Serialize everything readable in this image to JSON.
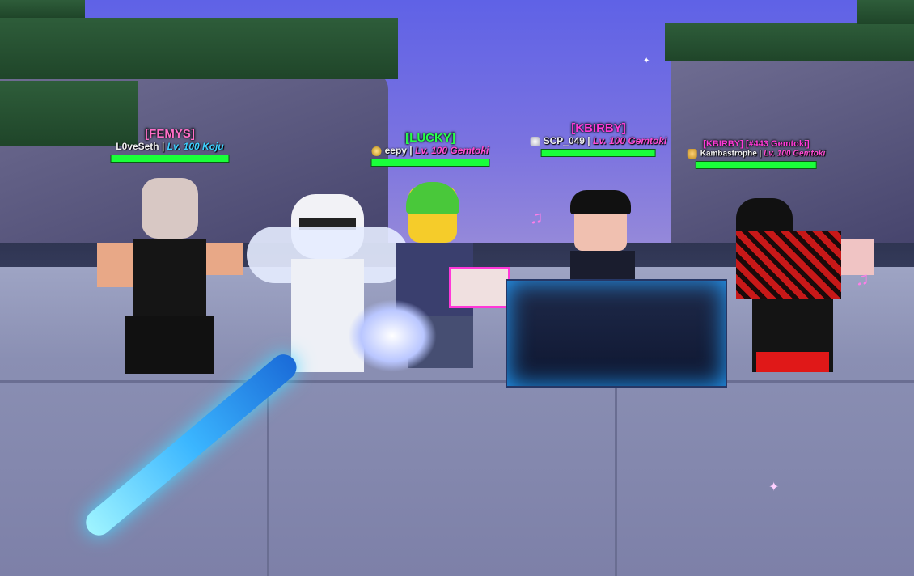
{
  "nameplates": [
    {
      "title": "[FEMYS]",
      "title_color": "#ff6ec7",
      "name": "L0veSeth",
      "sep": " | ",
      "level": "Lv. 100 Koju",
      "level_color": "#3fd0ff",
      "badge_icon": "none"
    },
    {
      "title": "[LUCKY]",
      "title_color": "#28ff4a",
      "name": "eepy",
      "sep": " | ",
      "level": "Lv. 100 Gemtoki",
      "level_color": "#ff4ad2",
      "badge_icon": "gold-medal-icon"
    },
    {
      "title": "[KBIRBY]",
      "title_color": "#ff3ad8",
      "name": "SCP_049",
      "sep": " | ",
      "level": "Lv. 100 Gemtoki",
      "level_color": "#ff4ad2",
      "badge_icon": "silver-wings-icon"
    },
    {
      "title": "[KBIRBY] [#443 Gemtoki]",
      "title_color": "#ff3ad8",
      "name": "Kambastrophe",
      "sep": " | ",
      "level": "Lv. 100 Gemtoki",
      "level_color": "#ff4ad2",
      "badge_icon": "gold-shield-icon"
    }
  ],
  "health": [
    1.0,
    1.0,
    1.0,
    1.0
  ],
  "colors": {
    "health_bar": "#1aff3a",
    "sky": "#6a66d8",
    "floor": "#8a8fb3"
  }
}
